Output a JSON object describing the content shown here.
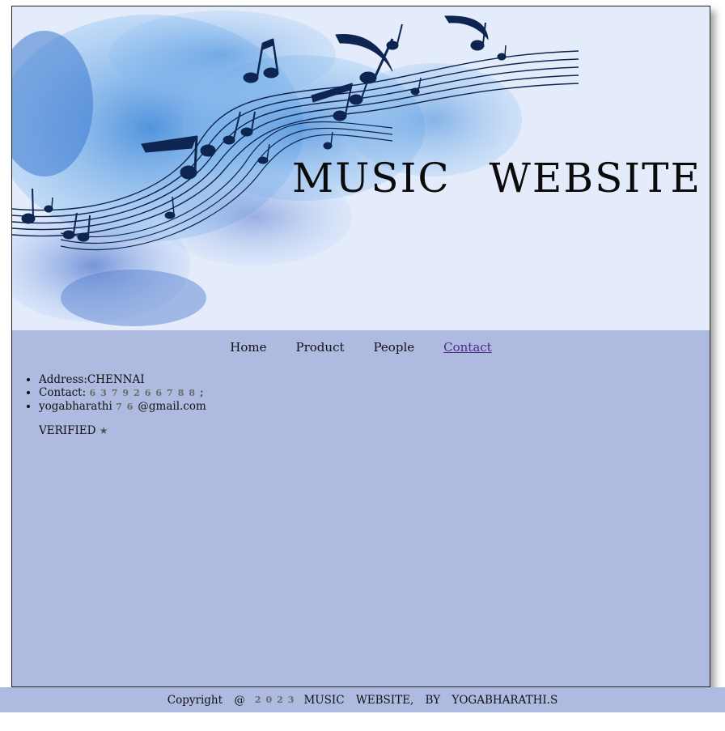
{
  "banner": {
    "title": "MUSIC WEBSITE",
    "image_icon": "music-notes-watercolor"
  },
  "nav": {
    "items": [
      {
        "label": "Home"
      },
      {
        "label": "Product"
      },
      {
        "label": "People"
      },
      {
        "label": "Contact",
        "active": true
      }
    ]
  },
  "contact": {
    "address": "Address:CHENNAI",
    "phone_label": "Contact:",
    "phone_digits": "6379266788",
    "phone_suffix": ";",
    "email_prefix": "yogabharathi",
    "email_digits": "76",
    "email_suffix": "@gmail.com"
  },
  "verified": {
    "label": "VERIFIED",
    "icon": "star-icon"
  },
  "footer": {
    "copyright": "Copyright @",
    "year": "2023",
    "text": "MUSIC WEBSITE, BY YOGABHARATHI.S"
  },
  "colors": {
    "content_bg": "#aebadf",
    "banner_bg": "#e4ecfb",
    "link_active": "#4b2a8a"
  }
}
